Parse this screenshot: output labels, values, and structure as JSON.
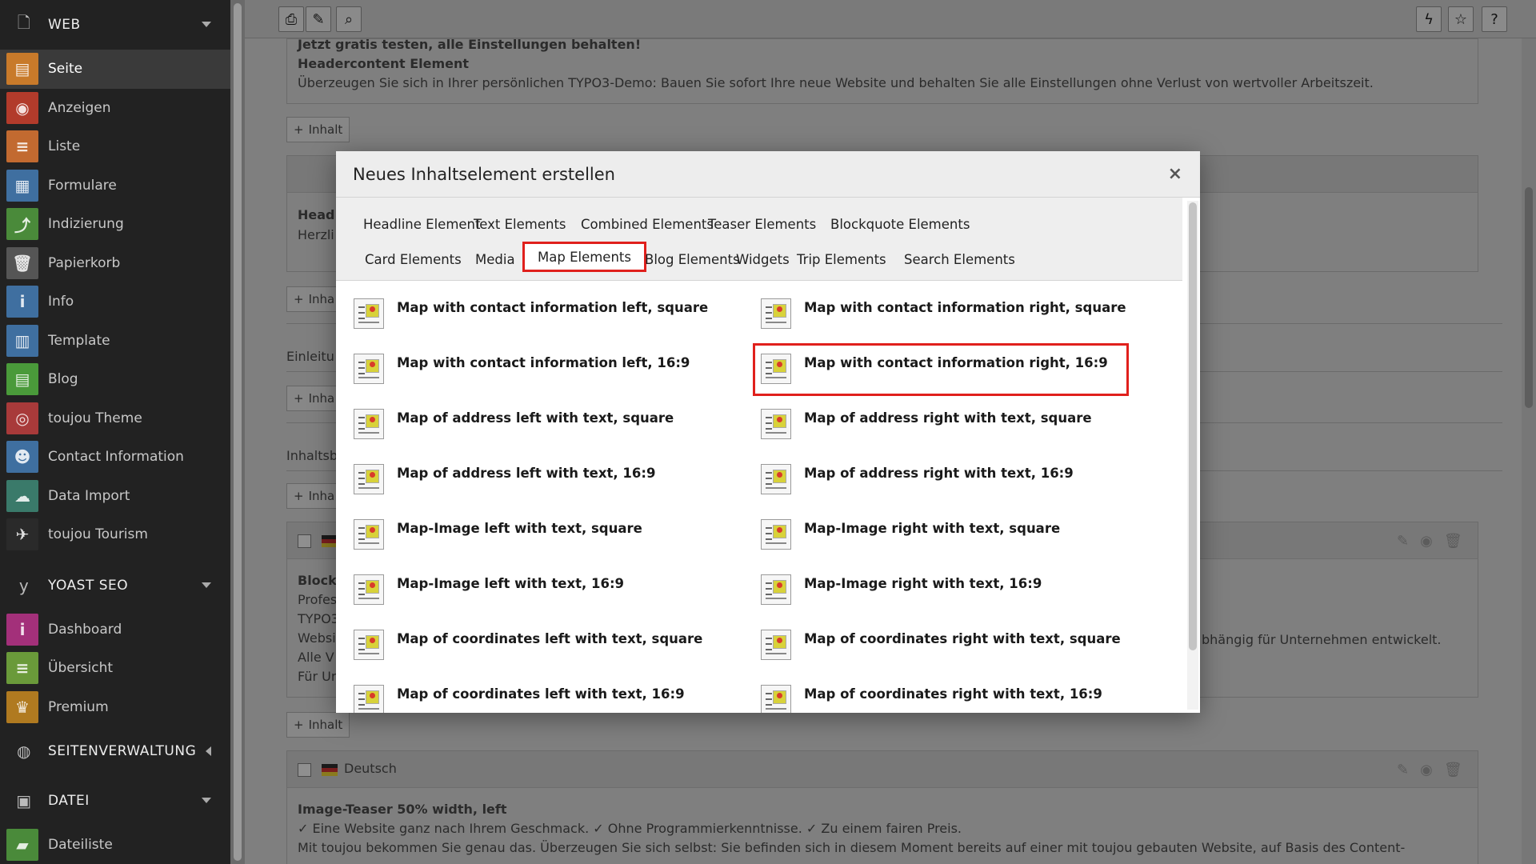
{
  "sidebar": {
    "group_web": "WEB",
    "web_items": [
      {
        "label": "Seite",
        "icon": "page-icon",
        "color": "#c87a2a"
      },
      {
        "label": "Anzeigen",
        "icon": "eye-icon",
        "color": "#b23b2b"
      },
      {
        "label": "Liste",
        "icon": "list-icon",
        "color": "#c26a30"
      },
      {
        "label": "Formulare",
        "icon": "form-icon",
        "color": "#3f6fa0"
      },
      {
        "label": "Indizierung",
        "icon": "chart-icon",
        "color": "#4a8a3a"
      },
      {
        "label": "Papierkorb",
        "icon": "trash-icon",
        "color": "#555555"
      },
      {
        "label": "Info",
        "icon": "info-icon",
        "color": "#3f6fa0"
      },
      {
        "label": "Template",
        "icon": "template-icon",
        "color": "#3f6fa0"
      },
      {
        "label": "Blog",
        "icon": "blog-icon",
        "color": "#4a9a3a"
      },
      {
        "label": "toujou Theme",
        "icon": "fingerprint-icon",
        "color": "#a83a3a"
      },
      {
        "label": "Contact Information",
        "icon": "contact-icon",
        "color": "#3f6fa0"
      },
      {
        "label": "Data Import",
        "icon": "cloud-icon",
        "color": "#3a7a6a"
      },
      {
        "label": "toujou Tourism",
        "icon": "plane-icon",
        "color": "#2a2a2a"
      }
    ],
    "group_yoast": "YOAST SEO",
    "yoast_items": [
      {
        "label": "Dashboard",
        "icon": "info-icon",
        "color": "#a3307a"
      },
      {
        "label": "Übersicht",
        "icon": "list-icon",
        "color": "#6a9a3a"
      },
      {
        "label": "Premium",
        "icon": "trophy-icon",
        "color": "#b07a20"
      }
    ],
    "group_seiten": "SEITENVERWALTUNG",
    "group_datei": "DATEI",
    "datei_items": [
      {
        "label": "Dateiliste",
        "icon": "folder-icon",
        "color": "#4a8a3a"
      }
    ]
  },
  "background": {
    "line1": "Jetzt gratis testen, alle Einstellungen behalten!",
    "line2": "Headercontent Element",
    "line3": "Überzeugen Sie sich in Ihrer persönlichen TYPO3-Demo: Bauen Sie sofort Ihre neue Website und behalten Sie alle Einstellungen ohne Verlust von wertvoller Arbeitszeit.",
    "inhalt": "Inhalt",
    "inhalt_short": "Inha",
    "head_short": "Head",
    "herzl_short": "Herzli",
    "einleitung_short": "Einleitu",
    "inhalts_short": "Inhaltsb",
    "block_short": "Block",
    "block_lines": [
      "Profes",
      "TYPO3",
      "Websi",
      "Alle V",
      "Für Ur"
    ],
    "block_right_text": "bhängig für Unternehmen entwickelt.",
    "lang": "Deutsch",
    "teaser_title": "Image-Teaser 50% width, left",
    "teaser_line1": "✓ Eine Website ganz nach Ihrem Geschmack.  ✓ Ohne Programmierkenntnisse. ✓ Zu einem fairen Preis.",
    "teaser_line2": "Mit toujou bekommen Sie genau das. Überzeugen Sie sich selbst: Sie befinden sich in diesem Moment bereits auf einer mit toujou gebauten Website, auf Basis des Content-"
  },
  "modal": {
    "title": "Neues Inhaltselement erstellen",
    "close": "×",
    "tabs_row1": [
      "Headline Element",
      "Text Elements",
      "Combined Elements",
      "Teaser Elements",
      "Blockquote Elements"
    ],
    "tabs_row2": [
      "Card Elements",
      "Media",
      "Map Elements",
      "Blog Elements",
      "Widgets",
      "Trip Elements",
      "Search Elements"
    ],
    "active_tab": "Map Elements",
    "elements_left": [
      "Map with contact information left, square",
      "Map with contact information left, 16:9",
      "Map of address left with text, square",
      "Map of address left with text, 16:9",
      "Map-Image left with text, square",
      "Map-Image left with text, 16:9",
      "Map of coordinates left with text, square",
      "Map of coordinates left with text, 16:9"
    ],
    "elements_right": [
      "Map with contact information right, square",
      "Map with contact information right, 16:9",
      "Map of address right with text, square",
      "Map of address right with text, 16:9",
      "Map-Image right with text, square",
      "Map-Image right with text, 16:9",
      "Map of coordinates right with text, square",
      "Map of coordinates right with text, 16:9"
    ],
    "highlighted_element": "Map with contact information right, 16:9"
  },
  "colors": {
    "highlight": "#e0201c",
    "sidebar_bg": "#222222"
  }
}
